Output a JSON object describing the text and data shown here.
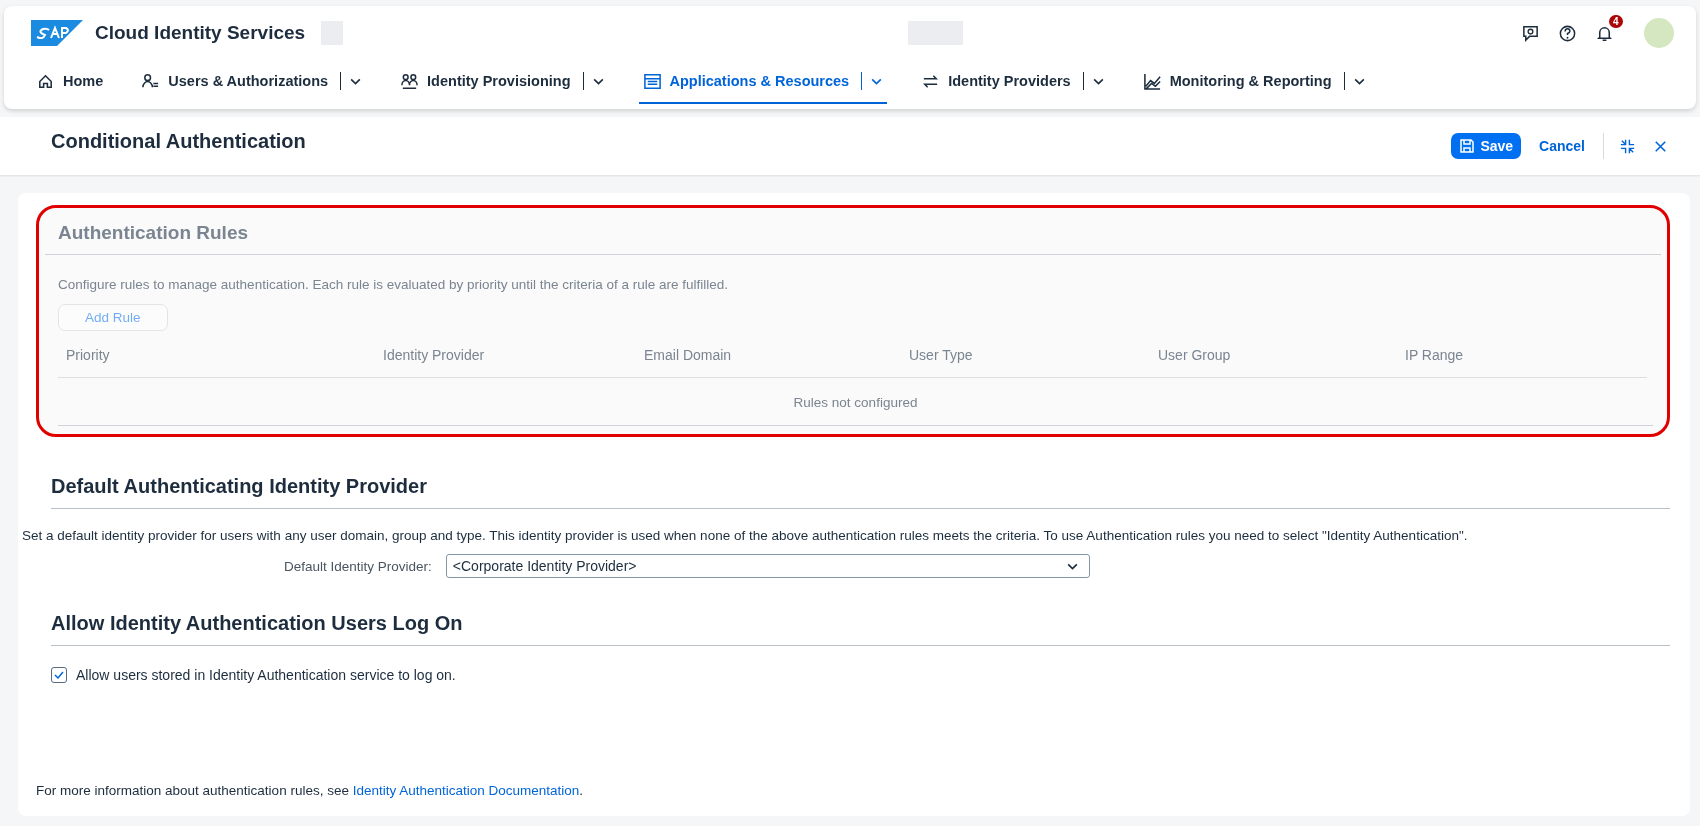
{
  "shell": {
    "product": "Cloud Identity Services",
    "notification_count": "4"
  },
  "nav": [
    {
      "label": "Home",
      "has_menu": false,
      "selected": false
    },
    {
      "label": "Users & Authorizations",
      "has_menu": true,
      "selected": false
    },
    {
      "label": "Identity Provisioning",
      "has_menu": true,
      "selected": false
    },
    {
      "label": "Applications & Resources",
      "has_menu": true,
      "selected": true
    },
    {
      "label": "Identity Providers",
      "has_menu": true,
      "selected": false
    },
    {
      "label": "Monitoring & Reporting",
      "has_menu": true,
      "selected": false
    }
  ],
  "page": {
    "title": "Conditional Authentication",
    "save": "Save",
    "cancel": "Cancel"
  },
  "rules": {
    "title": "Authentication Rules",
    "disabled": true,
    "highlighted": true,
    "description": "Configure rules to manage authentication. Each rule is evaluated by priority until the criteria of a rule are fulfilled.",
    "add_button": "Add Rule",
    "columns": [
      "Priority",
      "Identity Provider",
      "Email Domain",
      "User Type",
      "User Group",
      "IP Range"
    ],
    "empty_text": "Rules not configured"
  },
  "default_idp": {
    "title": "Default Authenticating Identity Provider",
    "description": "Set a default identity provider for users with any user domain, group and type. This identity provider is used when none of the above authentication rules meets the criteria. To use Authentication rules you need to select \"Identity Authentication\".",
    "label": "Default Identity Provider:",
    "value": "<Corporate Identity Provider>"
  },
  "allow_logon": {
    "title": "Allow Identity Authentication Users Log On",
    "checkbox_label": "Allow users stored in Identity Authentication service to log on.",
    "checked": true
  },
  "footer": {
    "text": "For more information about authentication rules, see ",
    "link": "Identity Authentication Documentation",
    "suffix": "."
  }
}
